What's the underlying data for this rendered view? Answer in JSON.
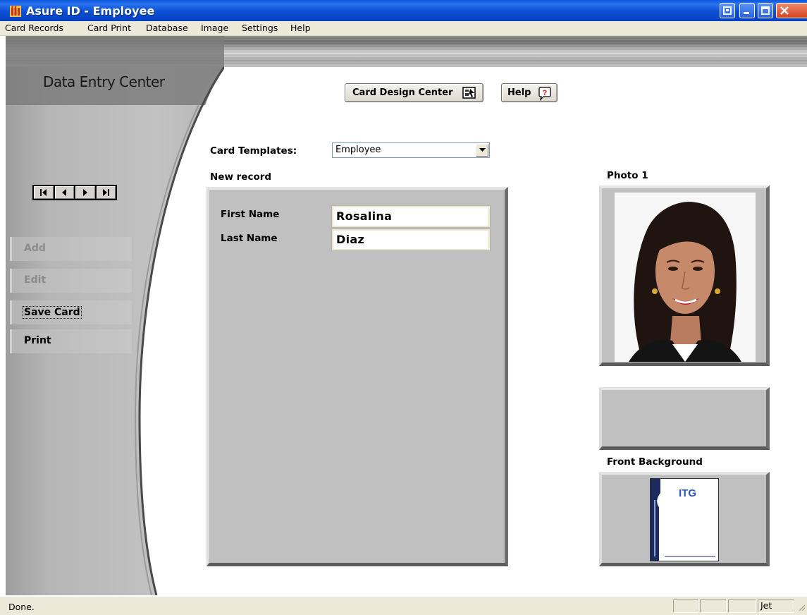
{
  "window": {
    "title": "Asure ID - Employee",
    "icon": "asure-id-logo-icon",
    "controls": [
      "restore-icon",
      "minimize-icon",
      "maximize-icon",
      "close-icon"
    ]
  },
  "menu": [
    "Card Records",
    "Card Print",
    "Database",
    "Image",
    "Settings",
    "Help"
  ],
  "sidebar": {
    "title": "Data Entry Center",
    "record_nav_icons": [
      "first-record-icon",
      "previous-record-icon",
      "next-record-icon",
      "last-record-icon"
    ],
    "buttons": [
      {
        "label": "Add",
        "enabled": false
      },
      {
        "label": "Edit",
        "enabled": false
      },
      {
        "label": "Save Card",
        "enabled": true,
        "focused": true
      },
      {
        "label": "Print",
        "enabled": true
      }
    ]
  },
  "toolbar": {
    "card_design_label": "Card Design Center",
    "card_design_icon": "card-design-icon",
    "help_label": "Help",
    "help_icon": "help-question-icon"
  },
  "form": {
    "templates_label": "Card Templates:",
    "template_value": "Employee",
    "record_status": "New record",
    "fields": [
      {
        "label": "First Name",
        "value": "Rosalina"
      },
      {
        "label": "Last Name",
        "value": "Diaz"
      }
    ]
  },
  "images": {
    "photo_label": "Photo 1",
    "background_label": "Front Background",
    "background_card_text": "ITG"
  },
  "status": {
    "text": "Done.",
    "cells": [
      "",
      "",
      "",
      "Jet"
    ]
  },
  "colors": {
    "titlebar_blue": "#0a4fd3",
    "menubar": "#ece9d8",
    "panel_gray": "#c0c0c0",
    "sidebar_gray": "#bdbdbd"
  }
}
